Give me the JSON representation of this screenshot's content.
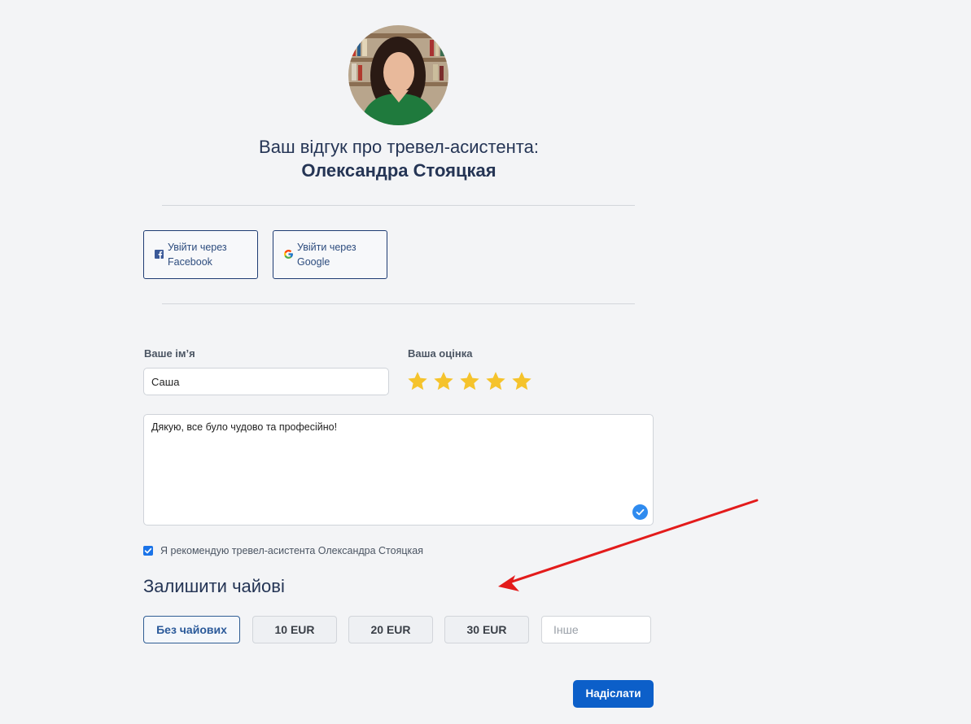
{
  "header": {
    "title": "Ваш відгук про тревел-асистента:",
    "assistant_name": "Олександра Стояцкая"
  },
  "social": {
    "facebook_label": "Увійти через Facebook",
    "google_label": "Увійти через Google"
  },
  "form": {
    "name_label": "Ваше ім’я",
    "name_value": "Саша",
    "rating_label": "Ваша оцінка",
    "rating": 5,
    "rating_max": 5,
    "review_text": "Дякую, все було чудово та професійно!",
    "recommend_checked": true,
    "recommend_label": "Я рекомендую тревел-асистента Олександра Стояцкая"
  },
  "tips": {
    "heading": "Залишити чайові",
    "options": [
      "Без чайових",
      "10 EUR",
      "20 EUR",
      "30 EUR"
    ],
    "selected": "Без чайових",
    "other_placeholder": "Інше"
  },
  "submit_label": "Надіслати",
  "colors": {
    "background": "#f3f4f6",
    "primary": "#0c5fc9",
    "star": "#f5c32c",
    "annotation_arrow": "#e31b1b"
  }
}
